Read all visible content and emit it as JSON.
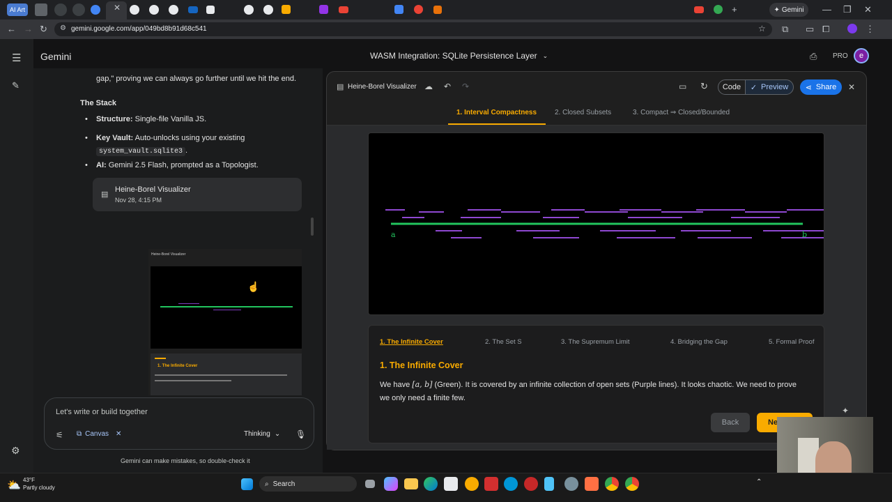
{
  "browser": {
    "first_tab_label": "AI Art",
    "url": "gemini.google.com/app/049bd8b91d68c541",
    "gemini_button_label": "Gemini"
  },
  "app": {
    "brand": "Gemini",
    "conversation_title": "WASM Integration: SQLite Persistence Layer",
    "pro_label": "PRO",
    "avatar_letter": "e"
  },
  "chat": {
    "intro_text": "gap,\" proving we can always go further until we hit the end.",
    "stack_heading": "The Stack",
    "bullets": [
      {
        "bold": "Structure:",
        "text": " Single-file Vanilla JS."
      },
      {
        "bold": "Key Vault:",
        "text": " Auto-unlocks using your existing",
        "code": "system_vault.sqlite3",
        "tail": "."
      },
      {
        "bold": "AI:",
        "text": " Gemini 2.5 Flash, prompted as a Topologist."
      }
    ],
    "canvas_card": {
      "title": "Heine-Borel Visualizer",
      "date": "Nov 28, 4:15 PM"
    },
    "preview_title": "Heine-Borel Visualizer",
    "preview_card_heading": "1. The Infinite Cover",
    "input_placeholder": "Let's write or build together",
    "canvas_chip": "Canvas",
    "thinking_label": "Thinking",
    "disclaimer": "Gemini can make mistakes, so double-check it"
  },
  "canvas": {
    "title": "Heine-Borel Visualizer",
    "code_label": "Code",
    "preview_label": "Preview",
    "share_label": "Share",
    "tabs": [
      "1. Interval Compactness",
      "2. Closed Subsets",
      "3. Compact ⇒ Closed/Bounded"
    ],
    "active_tab": 0,
    "stage": {
      "label_a": "a",
      "label_b": "b"
    },
    "steps": [
      "1. The Infinite Cover",
      "2. The Set S",
      "3. The Supremum Limit",
      "4. Bridging the Gap",
      "5. Formal Proof"
    ],
    "active_step": 0,
    "card_heading": "1. The Infinite Cover",
    "card_text_pre": "We have ",
    "card_math": "[a, b]",
    "card_text_post": " (Green). It is covered by an infinite collection of open sets (Purple lines). It looks chaotic. We need to prove we only need a finite few.",
    "back_label": "Back",
    "next_label": "Next"
  },
  "taskbar": {
    "temperature": "43°F",
    "weather": "Partly cloudy",
    "search_label": "Search"
  },
  "colors": {
    "accent_orange": "#f9ab00",
    "interval_green": "#22c55e",
    "cover_purple": "#a855f7",
    "share_blue": "#1a73e8"
  }
}
